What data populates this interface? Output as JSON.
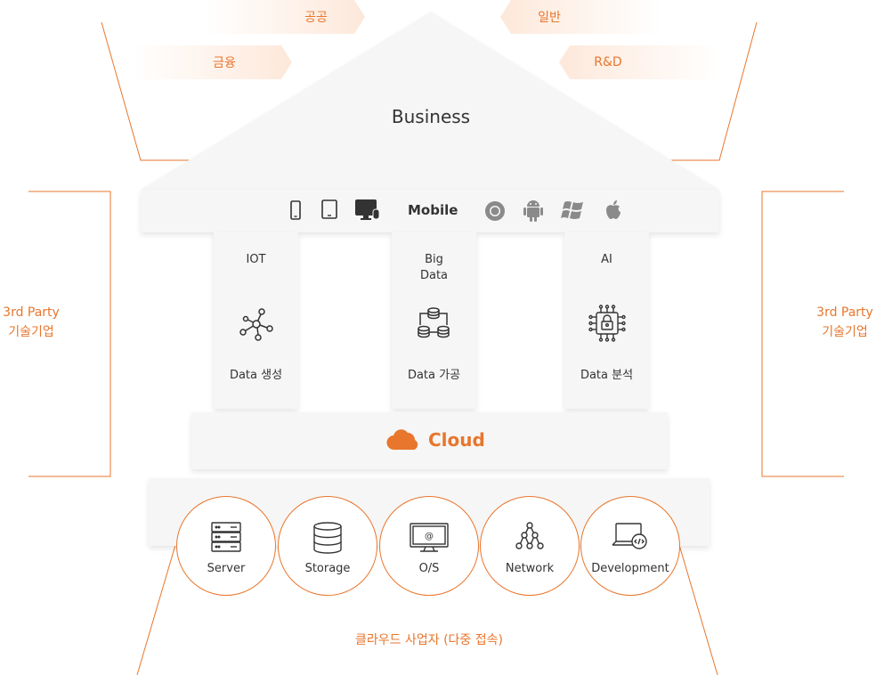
{
  "roof": {
    "title": "Business",
    "ribbons": {
      "public": "공공",
      "general": "일반",
      "finance": "금융",
      "rnd": "R&D"
    }
  },
  "mobile": {
    "label": "Mobile",
    "device_icons": [
      "phone-icon",
      "tablet-icon",
      "desktop-icon"
    ],
    "platform_icons": [
      "chrome-icon",
      "android-icon",
      "windows-icon",
      "apple-icon"
    ]
  },
  "pillars": [
    {
      "title": "IOT",
      "icon": "network-nodes-icon",
      "caption": "Data 생성"
    },
    {
      "title_line1": "Big",
      "title_line2": "Data",
      "icon": "database-flow-icon",
      "caption": "Data 가공"
    },
    {
      "title": "AI",
      "icon": "ai-chip-icon",
      "caption": "Data 분석"
    }
  ],
  "cloud": {
    "label": "Cloud",
    "icon": "cloud-icon"
  },
  "infrastructure": [
    {
      "label": "Server",
      "icon": "server-icon"
    },
    {
      "label": "Storage",
      "icon": "storage-icon"
    },
    {
      "label": "O/S",
      "icon": "monitor-icon"
    },
    {
      "label": "Network",
      "icon": "network-tree-icon"
    },
    {
      "label": "Development",
      "icon": "laptop-code-icon"
    }
  ],
  "footer": "클라우드 사업자 (다중 접속)",
  "side_left": {
    "line1": "3rd Party",
    "line2": "기술기업"
  },
  "side_right": {
    "line1": "3rd Party",
    "line2": "기술기업"
  },
  "colors": {
    "accent": "#e8762d",
    "panel": "#f6f6f6",
    "text": "#333333"
  }
}
